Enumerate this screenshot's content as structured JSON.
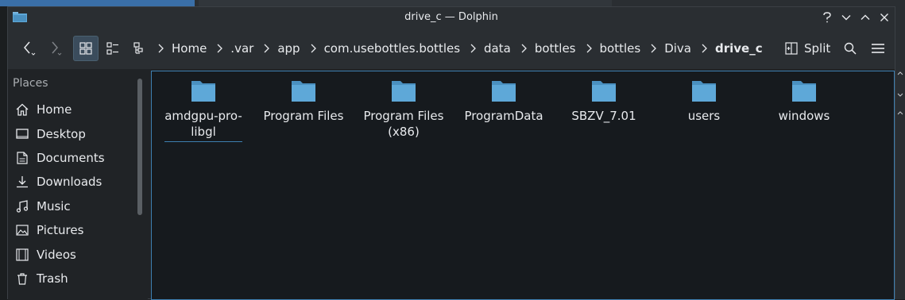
{
  "window": {
    "title": "drive_c — Dolphin"
  },
  "titlebar_buttons": [
    "help-icon",
    "minimize-icon",
    "maximize-icon",
    "close-icon"
  ],
  "toolbar": {
    "split_label": "Split"
  },
  "breadcrumb": [
    ".var",
    "app",
    "com.usebottles.bottles",
    "data",
    "bottles",
    "bottles",
    "Diva"
  ],
  "breadcrumb_home": "Home",
  "breadcrumb_current": "drive_c",
  "sidebar": {
    "title": "Places",
    "items": [
      {
        "label": "Home",
        "icon": "home-icon"
      },
      {
        "label": "Desktop",
        "icon": "desktop-icon"
      },
      {
        "label": "Documents",
        "icon": "documents-icon"
      },
      {
        "label": "Downloads",
        "icon": "downloads-icon"
      },
      {
        "label": "Music",
        "icon": "music-icon"
      },
      {
        "label": "Pictures",
        "icon": "pictures-icon"
      },
      {
        "label": "Videos",
        "icon": "videos-icon"
      },
      {
        "label": "Trash",
        "icon": "trash-icon"
      }
    ]
  },
  "files": [
    {
      "name": "amdgpu-pro-libgl"
    },
    {
      "name": "Program Files"
    },
    {
      "name": "Program Files (x86)"
    },
    {
      "name": "ProgramData"
    },
    {
      "name": "SBZV_7.01"
    },
    {
      "name": "users"
    },
    {
      "name": "windows"
    }
  ],
  "colors": {
    "folder": "#5ea8d8",
    "accent": "#3d7eb0"
  }
}
